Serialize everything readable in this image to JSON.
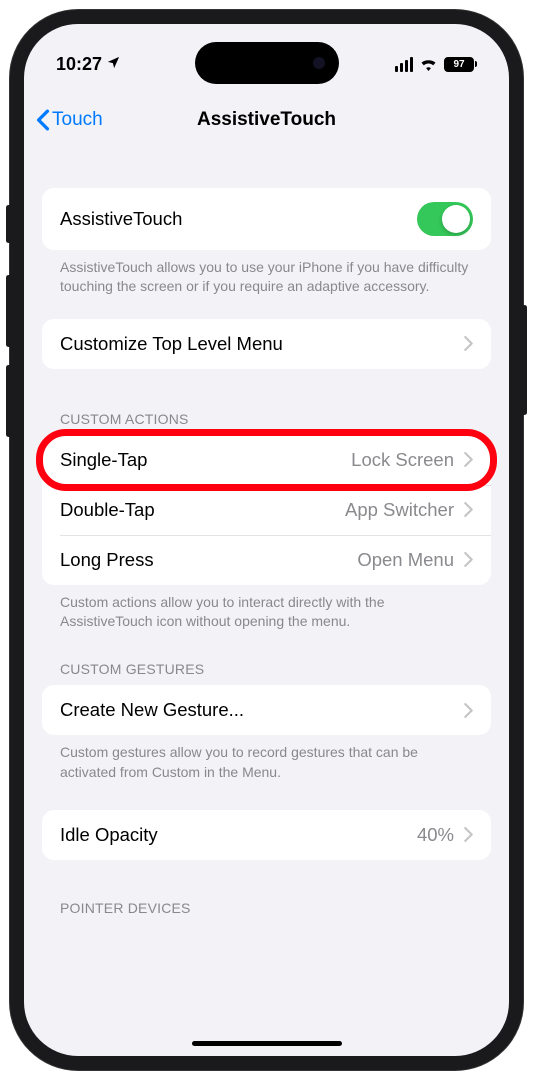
{
  "statusBar": {
    "time": "10:27",
    "battery": "97"
  },
  "nav": {
    "back": "Touch",
    "title": "AssistiveTouch"
  },
  "groups": {
    "main": {
      "toggleLabel": "AssistiveTouch",
      "footer": "AssistiveTouch allows you to use your iPhone if you have difficulty touching the screen or if you require an adaptive accessory.",
      "customizeLabel": "Customize Top Level Menu"
    },
    "customActions": {
      "header": "CUSTOM ACTIONS",
      "singleTap": {
        "label": "Single-Tap",
        "value": "Lock Screen"
      },
      "doubleTap": {
        "label": "Double-Tap",
        "value": "App Switcher"
      },
      "longPress": {
        "label": "Long Press",
        "value": "Open Menu"
      },
      "footer": "Custom actions allow you to interact directly with the AssistiveTouch icon without opening the menu."
    },
    "customGestures": {
      "header": "CUSTOM GESTURES",
      "createLabel": "Create New Gesture...",
      "footer": "Custom gestures allow you to record gestures that can be activated from Custom in the Menu."
    },
    "idleOpacity": {
      "label": "Idle Opacity",
      "value": "40%"
    },
    "pointerDevices": {
      "header": "POINTER DEVICES"
    }
  }
}
